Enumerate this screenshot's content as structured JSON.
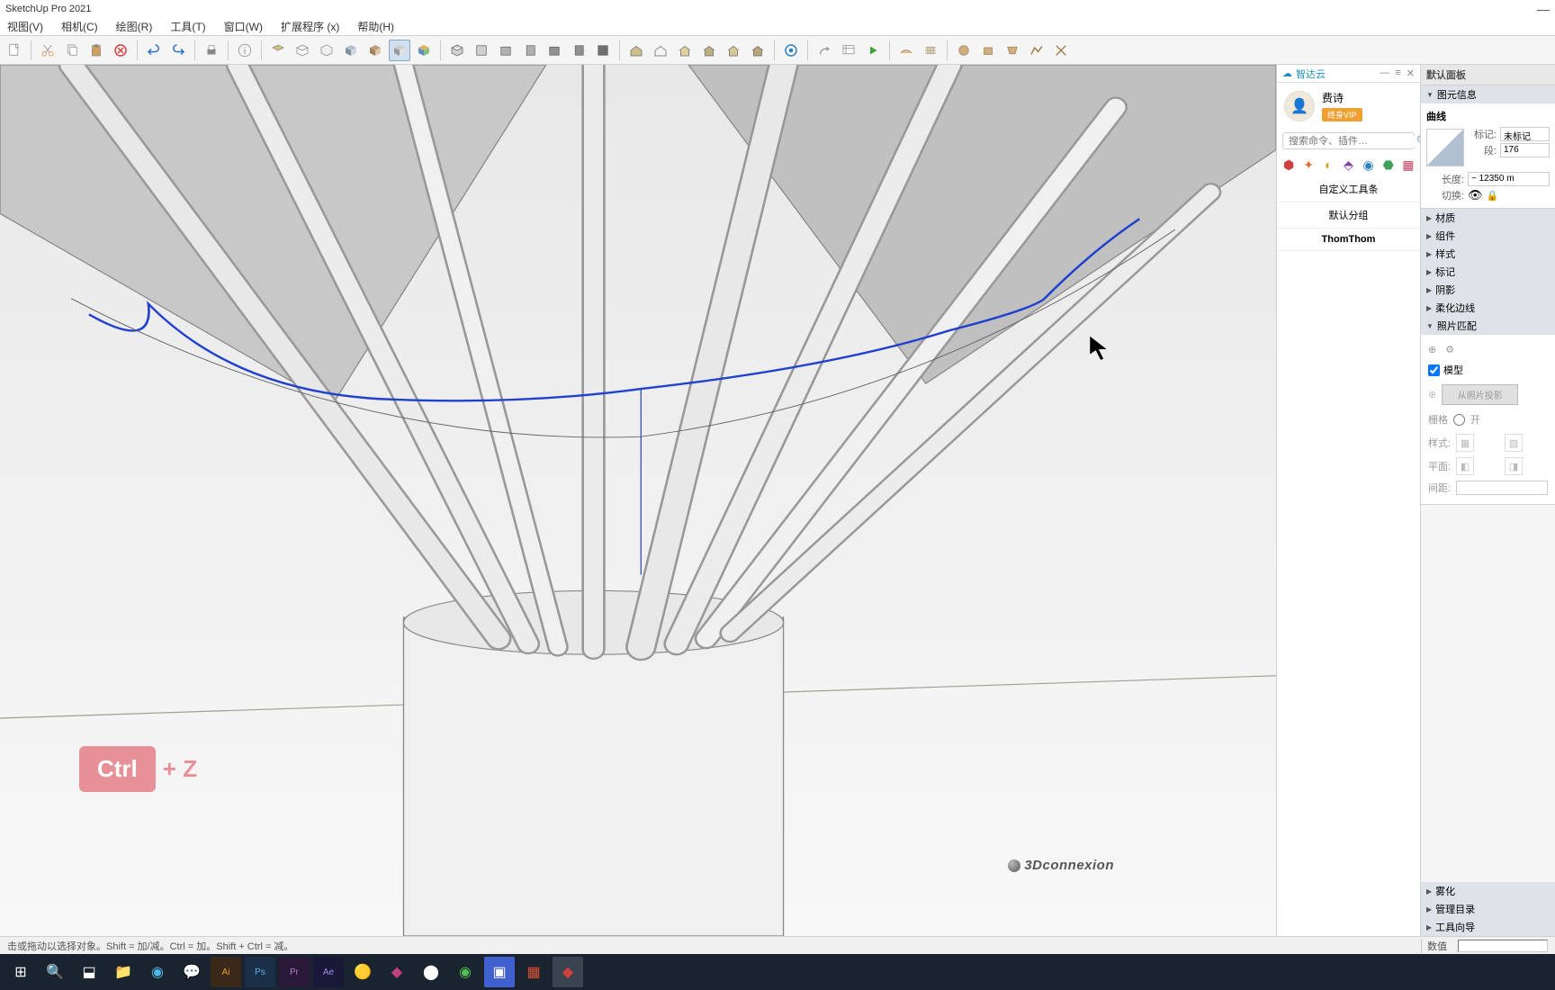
{
  "app": {
    "title": "SketchUp Pro 2021"
  },
  "menu": [
    "视图(V)",
    "相机(C)",
    "绘图(R)",
    "工具(T)",
    "窗口(W)",
    "扩展程序 (x)",
    "帮助(H)"
  ],
  "statusbar": {
    "hint": "击或拖动以选择对象。Shift = 加/减。Ctrl = 加。Shift + Ctrl = 减。",
    "value_label": "数值"
  },
  "hotkey": {
    "key": "Ctrl",
    "plus": "+ Z"
  },
  "watermark": "3Dconnexion",
  "plugin": {
    "title": "智达云",
    "username": "费诗",
    "vip": "终身VIP",
    "search_placeholder": "搜索命令、插件…",
    "items": [
      "自定义工具条",
      "默认分组",
      "ThomThom"
    ]
  },
  "right_panel": {
    "title": "默认面板",
    "entity_section": "图元信息",
    "entity_type": "曲线",
    "props": {
      "tag_label": "标记:",
      "tag_value": "未标记",
      "segments_label": "段:",
      "segments_value": "176",
      "length_label": "长度:",
      "length_value": "~ 12350 m",
      "toggle_label": "切换:"
    },
    "collapsed": [
      "材质",
      "组件",
      "样式",
      "标记",
      "阴影",
      "柔化边线"
    ],
    "photo_section": "照片匹配",
    "photo": {
      "model_chk": "模型",
      "project_btn": "从照片投影",
      "grids_label": "栅格",
      "grids_on": "开",
      "styles_label": "样式:",
      "planes_label": "平面:",
      "spacing_label": "间距:"
    },
    "bottom_collapsed": [
      "雾化",
      "管理目录",
      "工具向导"
    ]
  }
}
